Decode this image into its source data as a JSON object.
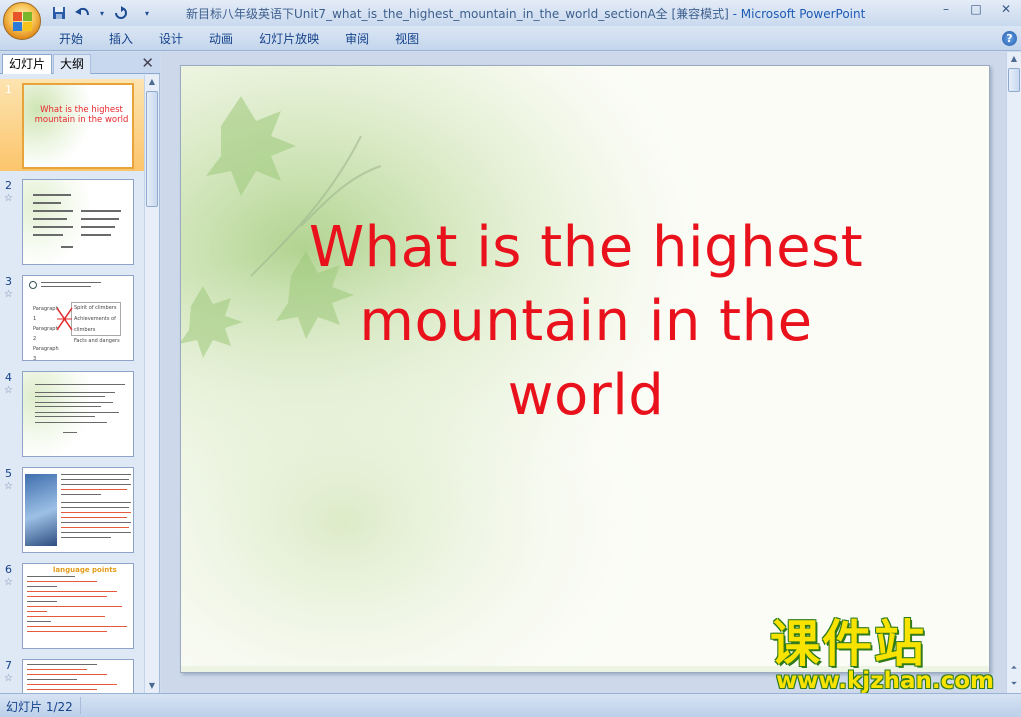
{
  "window": {
    "title": "新目标八年级英语下Unit7_what_is_the_highest_mountain_in_the_world_sectionA全 [兼容模式]",
    "app_suffix": " - Microsoft PowerPoint",
    "controls": [
      "–",
      "□",
      "✕"
    ]
  },
  "quick_access": {
    "save_icon": "save-icon",
    "undo_icon": "undo-icon",
    "redo_icon": "redo-icon",
    "customize_icon": "dropdown-icon"
  },
  "ribbon": {
    "tabs": [
      "开始",
      "插入",
      "设计",
      "动画",
      "幻灯片放映",
      "审阅",
      "视图"
    ],
    "help": "?"
  },
  "panel": {
    "tab_slides": "幻灯片",
    "tab_outline": "大纲",
    "close": "✕",
    "thumbnails": [
      {
        "num": "1",
        "star": "",
        "title": "What is the highest mountain in the world"
      },
      {
        "num": "2",
        "star": "☆"
      },
      {
        "num": "3",
        "star": "☆",
        "labels": [
          "Paragraph 1",
          "Paragraph 2",
          "Paragraph 3",
          "Spirit of climbers",
          "Achievements of climbers",
          "Facts and dangers"
        ]
      },
      {
        "num": "4",
        "star": "☆"
      },
      {
        "num": "5",
        "star": "☆"
      },
      {
        "num": "6",
        "star": "☆",
        "heading": "language points"
      },
      {
        "num": "7",
        "star": "☆"
      }
    ]
  },
  "slide": {
    "title_line1": "What is the highest",
    "title_line2": "mountain in the world"
  },
  "watermark": {
    "main": "课件站",
    "url": "www.kjzhan.com"
  },
  "status": {
    "slide_counter": "幻灯片 1/22"
  },
  "colors": {
    "title_red": "#e9121c",
    "selected_thumb": "#fbc56c",
    "ribbon_bg": "#c4d6ec",
    "watermark_yellow": "#f7e200",
    "watermark_green": "#2f7a1b"
  }
}
